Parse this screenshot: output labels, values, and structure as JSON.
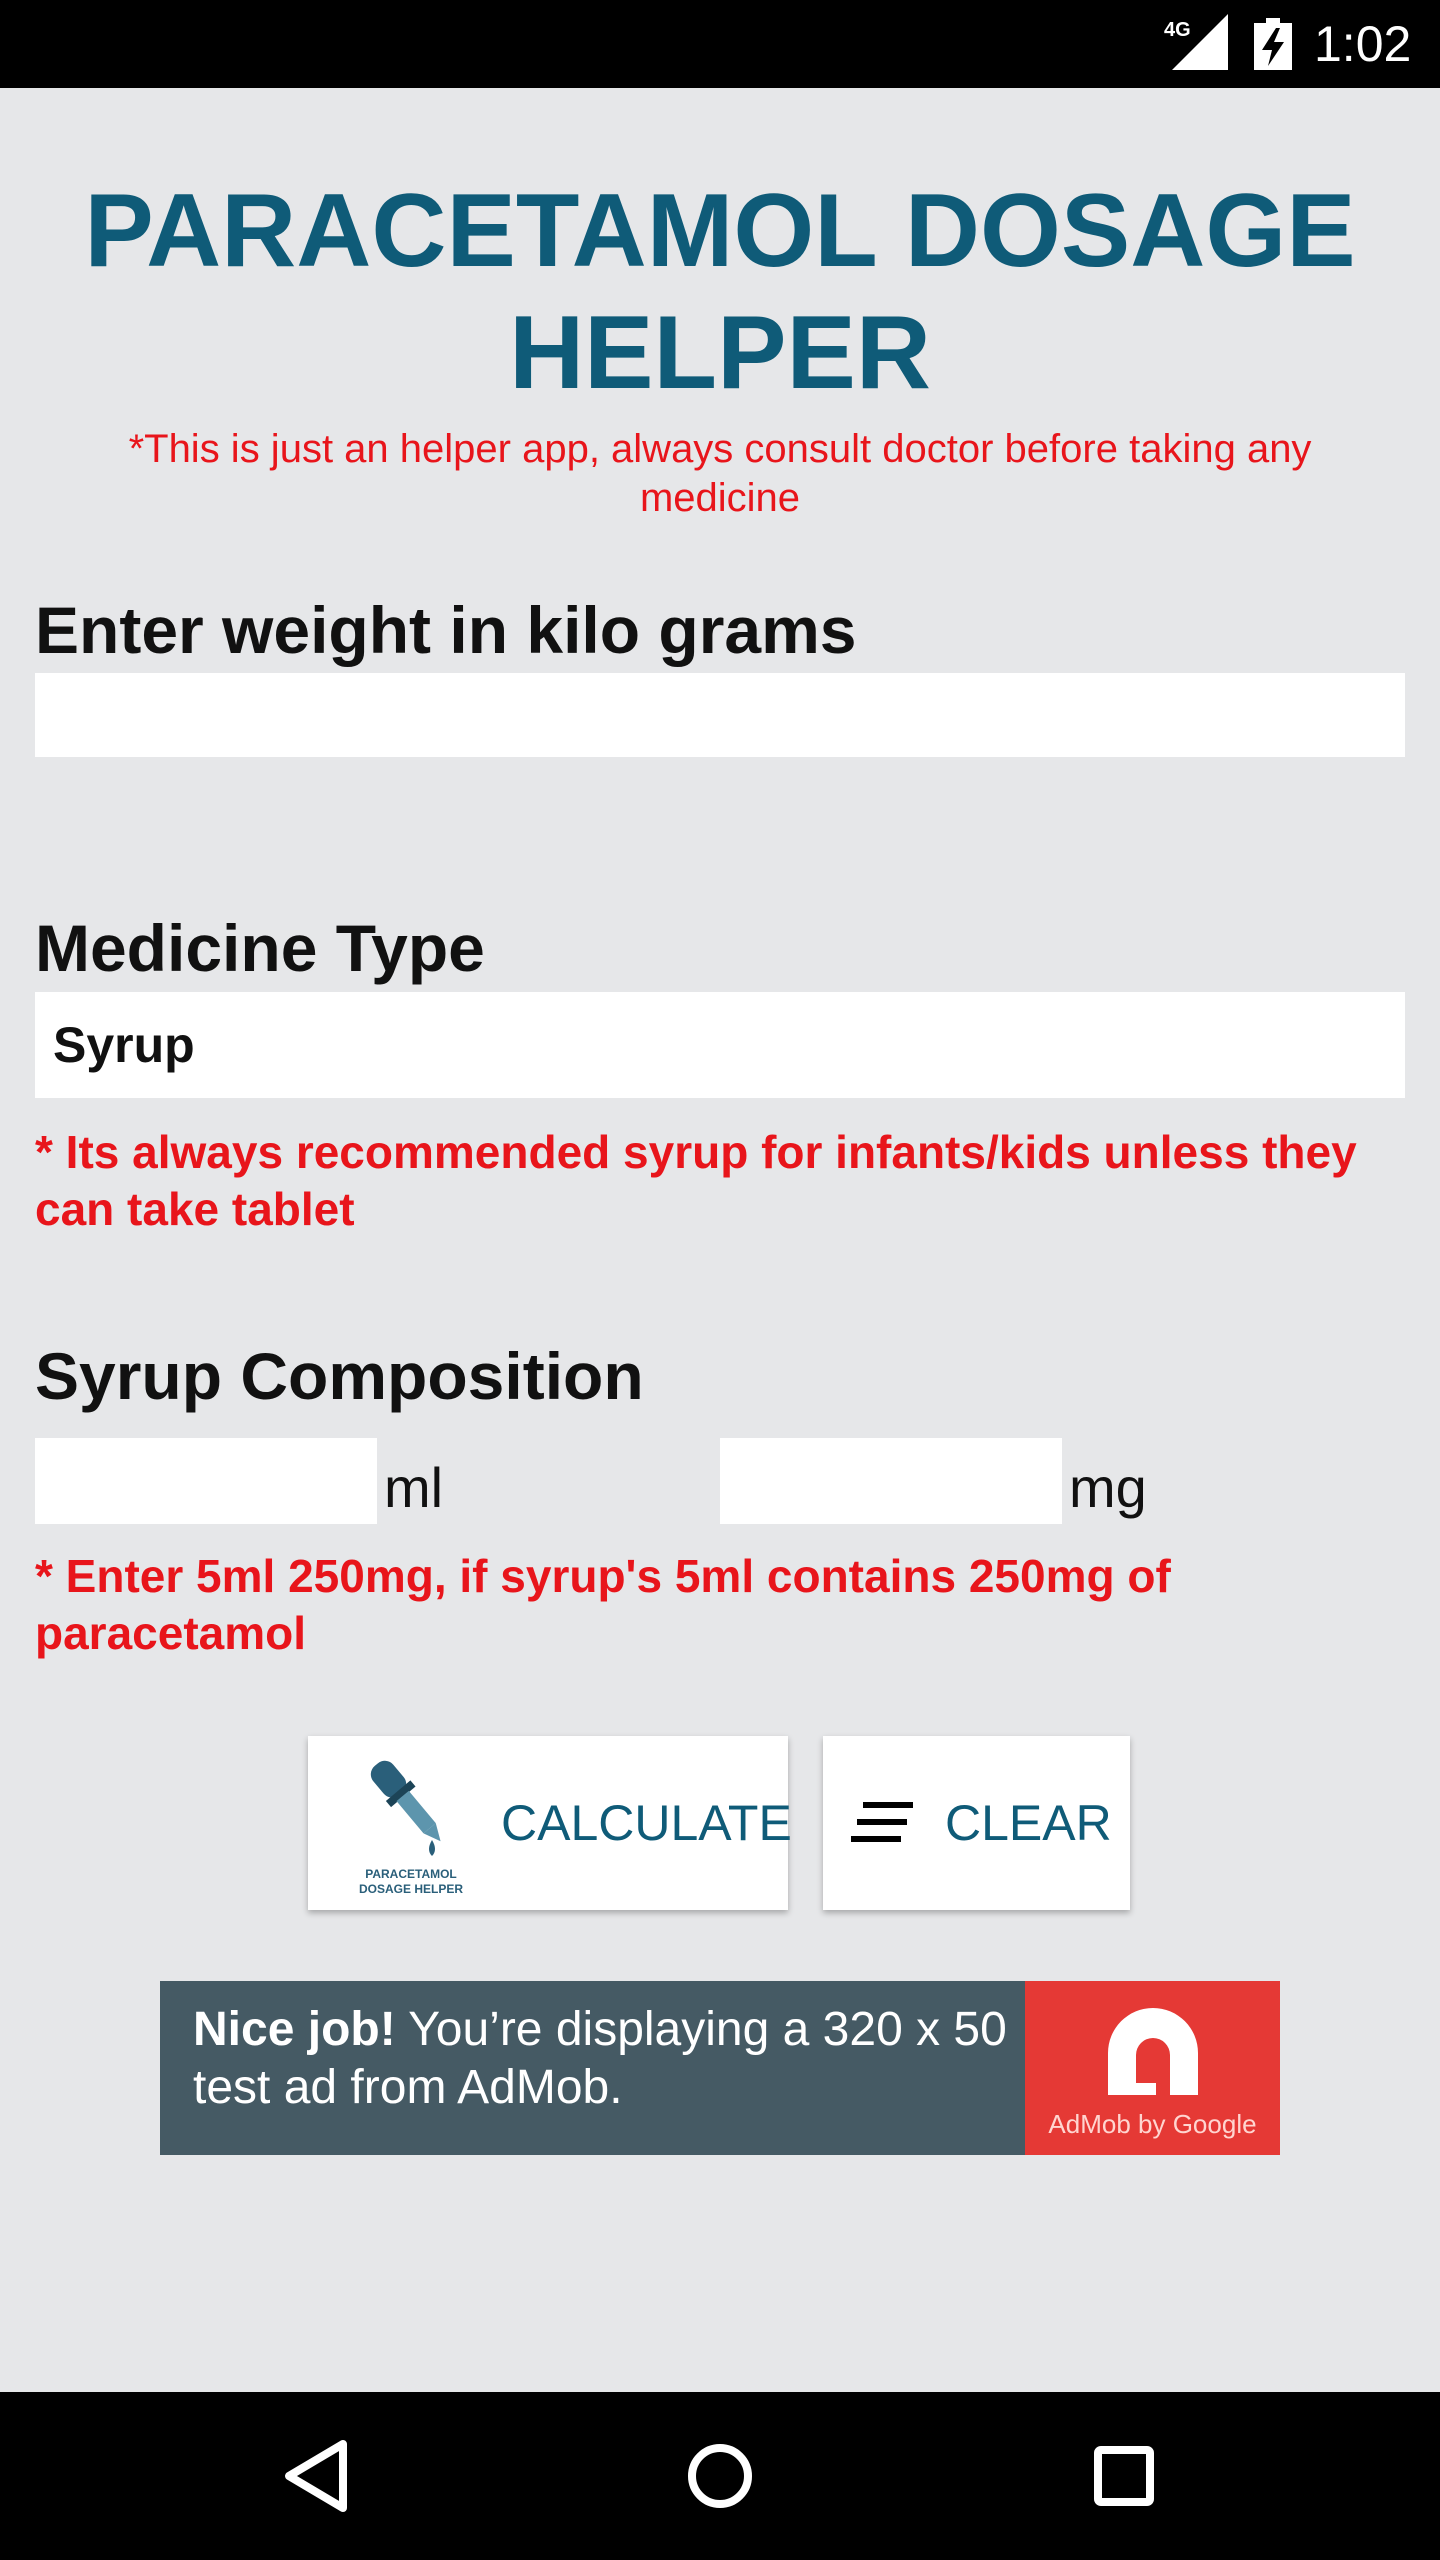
{
  "status_bar": {
    "network": "4G",
    "time": "1:02"
  },
  "app": {
    "title": "PARACETAMOL DOSAGE HELPER",
    "disclaimer": "*This is just an helper app, always consult doctor before taking any medicine"
  },
  "weight": {
    "label": "Enter weight in kilo grams",
    "value": "",
    "placeholder": ""
  },
  "medicine": {
    "label": "Medicine Type",
    "selected": "Syrup",
    "note": "* Its always recommended syrup for infants/kids unless they can take tablet"
  },
  "composition": {
    "label": "Syrup Composition",
    "ml_value": "",
    "ml_unit": "ml",
    "mg_value": "",
    "mg_unit": "mg",
    "note": "* Enter 5ml 250mg, if syrup's 5ml contains 250mg of paracetamol"
  },
  "buttons": {
    "calculate": "CALCULATE",
    "calculate_logo_text": "PARACETAMOL DOSAGE HELPER",
    "clear": "CLEAR"
  },
  "ad": {
    "headline": "Nice job!",
    "body": " You’re displaying a 320 x 50 test ad from AdMob.",
    "brand": "AdMob by Google"
  },
  "colors": {
    "title": "#0f5b78",
    "warning": "#e8151b",
    "background": "#e6e7e9",
    "ad_background": "#455a64",
    "ad_accent": "#e53935"
  },
  "icons": [
    "network-4g-icon",
    "battery-charging-icon",
    "dropper-logo-icon",
    "clear-lines-icon",
    "admob-logo-icon",
    "nav-back-icon",
    "nav-home-icon",
    "nav-recents-icon"
  ]
}
